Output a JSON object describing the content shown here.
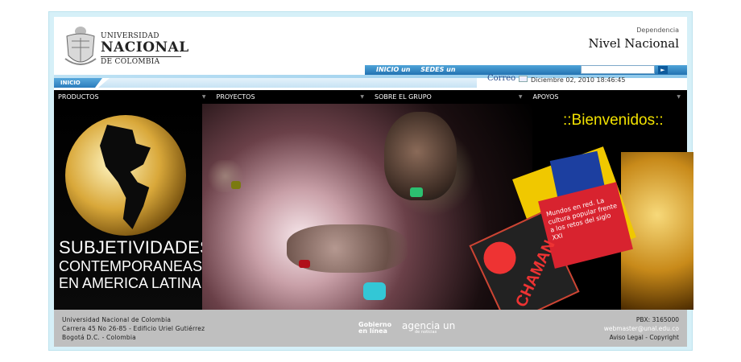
{
  "header": {
    "logo_line1": "UNIVERSIDAD",
    "logo_line2": "NACIONAL",
    "logo_line3": "DE COLOMBIA",
    "dependencia": "Dependencia",
    "nivel": "Nivel Nacional"
  },
  "nav": {
    "tabs": [
      "INICIO un",
      "SEDES un"
    ],
    "search_value": "",
    "search_button": "►",
    "inicio": "INICIO",
    "correo": "Correo",
    "datetime": "Diciembre 02, 2010 18:46:45"
  },
  "menu": {
    "items": [
      {
        "label": "PRODUCTOS"
      },
      {
        "label": "PROYECTOS"
      },
      {
        "label": "SOBRE EL GRUPO"
      },
      {
        "label": "APOYOS"
      }
    ]
  },
  "banner": {
    "subjetividades_1": "SUBJETIVIDADES",
    "subjetividades_2": "CONTEMPORANEAS",
    "subjetividades_3": "EN AMERICA LATINA",
    "bienvenidos": "::Bienvenidos::",
    "book_text": "Mundos en red. La cultura popular frente a los retos del siglo XXI",
    "chaman": "CHAMAN"
  },
  "footer": {
    "left1": "Universidad Nacional de Colombia",
    "left2": "Carrera 45 No 26-85 - Edificio Uriel Gutiérrez",
    "left3": "Bogotá D.C. - Colombia",
    "gobierno1": "Gobierno",
    "gobierno2": "en línea",
    "agencia": "agencia un",
    "agencia_sub": "de noticias",
    "pbx": "PBX: 3165000",
    "email": "webmaster@unal.edu.co",
    "legal": "Aviso Legal - Copyright"
  }
}
